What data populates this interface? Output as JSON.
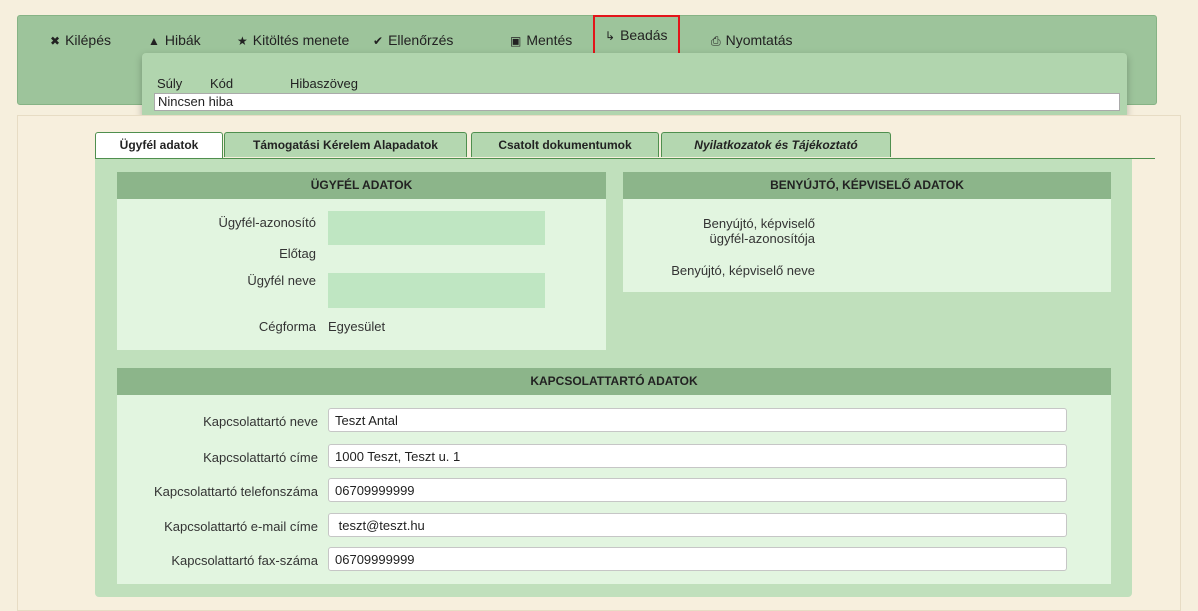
{
  "toolbar": {
    "items": [
      {
        "label": "Kilépés",
        "icon": "close-icon",
        "glyph": "✖"
      },
      {
        "label": "Hibák",
        "icon": "warning-icon",
        "glyph": "▲"
      },
      {
        "label": "Kitöltés menete",
        "icon": "star-icon",
        "glyph": "★"
      },
      {
        "label": "Ellenőrzés",
        "icon": "check-icon",
        "glyph": "✔"
      },
      {
        "label": "Mentés",
        "icon": "save-icon",
        "glyph": "▣"
      },
      {
        "label": "Beadás",
        "icon": "submit-icon",
        "glyph": "↳"
      },
      {
        "label": "Nyomtatás",
        "icon": "print-icon",
        "glyph": "⎙"
      }
    ],
    "active_item": "Beadás",
    "highlight_color": "#e3151a"
  },
  "errors": {
    "col_weight": "Súly",
    "col_code": "Kód",
    "col_text": "Hibaszöveg",
    "message": "Nincsen hiba"
  },
  "tabs": [
    {
      "label": "Ügyfél adatok"
    },
    {
      "label": "Támogatási Kérelem Alapadatok"
    },
    {
      "label": "Csatolt dokumentumok"
    },
    {
      "label": "Nyilatkozatok és Tájékoztató"
    }
  ],
  "client": {
    "title": "ÜGYFÉL ADATOK",
    "id_label": "Ügyfél-azonosító",
    "prefix_label": "Előtag",
    "name_label": "Ügyfél neve",
    "form_label": "Cégforma",
    "form_value": "Egyesület"
  },
  "submitter": {
    "title": "BENYÚJTÓ, KÉPVISELŐ ADATOK",
    "id_label_1": "Benyújtó, képviselő",
    "id_label_2": "ügyfél-azonosítója",
    "name_label": "Benyújtó, képviselő neve"
  },
  "contact": {
    "title": "KAPCSOLATTARTÓ ADATOK",
    "fields": [
      {
        "label": "Kapcsolattartó neve",
        "value": "Teszt Antal"
      },
      {
        "label": "Kapcsolattartó címe",
        "value": "1000 Teszt, Teszt u. 1"
      },
      {
        "label": "Kapcsolattartó telefonszáma",
        "value": "06709999999"
      },
      {
        "label": "Kapcsolattartó e-mail címe",
        "value": " teszt@teszt.hu"
      },
      {
        "label": "Kapcsolattartó fax-száma",
        "value": "06709999999"
      }
    ]
  }
}
